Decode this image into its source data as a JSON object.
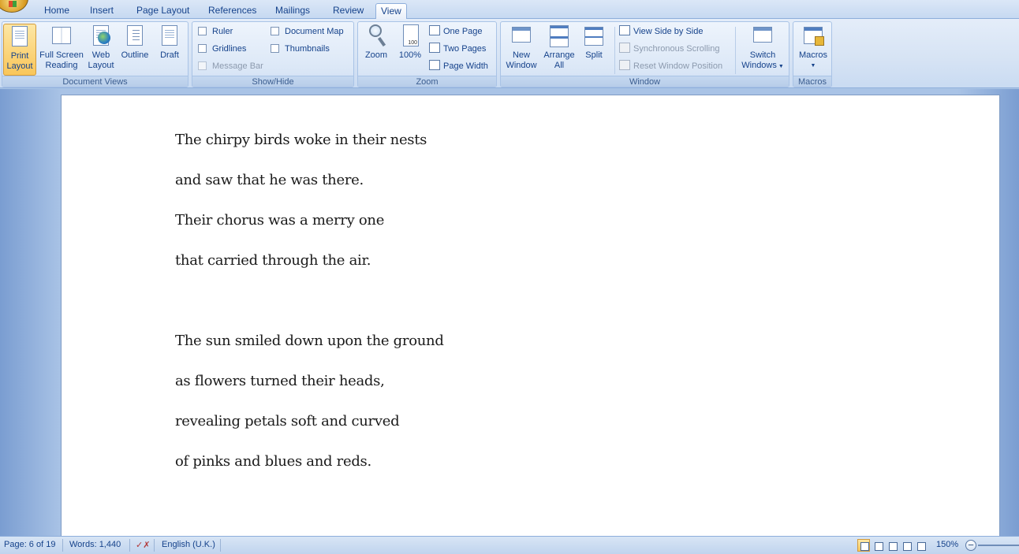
{
  "tabs": [
    "Home",
    "Insert",
    "Page Layout",
    "References",
    "Mailings",
    "Review",
    "View"
  ],
  "active_tab": "View",
  "ribbon": {
    "document_views": {
      "label": "Document Views",
      "print_layout": [
        "Print",
        "Layout"
      ],
      "full_screen": [
        "Full Screen",
        "Reading"
      ],
      "web_layout": [
        "Web",
        "Layout"
      ],
      "outline": "Outline",
      "draft": "Draft"
    },
    "show_hide": {
      "label": "Show/Hide",
      "ruler": "Ruler",
      "gridlines": "Gridlines",
      "message_bar": "Message Bar",
      "document_map": "Document Map",
      "thumbnails": "Thumbnails"
    },
    "zoom": {
      "label": "Zoom",
      "zoom": "Zoom",
      "hundred": "100%",
      "hundred_icon": "100",
      "one_page": "One Page",
      "two_pages": "Two Pages",
      "page_width": "Page Width"
    },
    "window": {
      "label": "Window",
      "new_window": [
        "New",
        "Window"
      ],
      "arrange_all": [
        "Arrange",
        "All"
      ],
      "split": "Split",
      "view_side_by_side": "View Side by Side",
      "synchronous_scrolling": "Synchronous Scrolling",
      "reset_window_position": "Reset Window Position",
      "switch_windows": [
        "Switch",
        "Windows"
      ]
    },
    "macros": {
      "label": "Macros",
      "macros": "Macros"
    }
  },
  "document": {
    "lines": [
      "The chirpy birds woke in their nests",
      "and saw that he was there.",
      "Their chorus was a merry one",
      "that carried through the air.",
      "The sun smiled down upon the ground",
      "as flowers turned their heads,",
      "revealing petals soft and curved",
      "of pinks and blues and reds."
    ]
  },
  "status": {
    "page": "Page: 6 of 19",
    "words": "Words: 1,440",
    "language": "English (U.K.)",
    "zoom": "150%"
  },
  "colors": {
    "accent": "#15428b",
    "selected": "#f9c65a"
  }
}
